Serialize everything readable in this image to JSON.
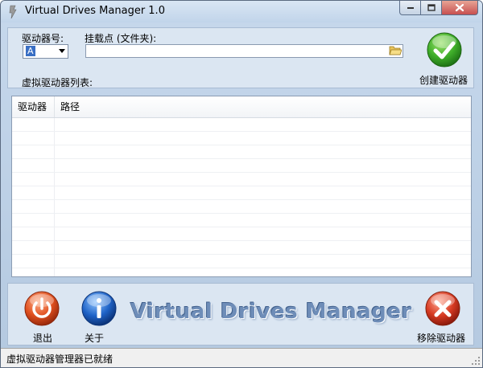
{
  "window": {
    "title": "Virtual Drives Manager 1.0",
    "controls": {
      "minimize": "minimize-icon",
      "maximize": "maximize-icon",
      "close": "close-icon"
    }
  },
  "form": {
    "drive_label": "驱动器号:",
    "drive_value": "A",
    "mount_label": "挂载点 (文件夹):",
    "mount_value": "",
    "list_label": "虚拟驱动器列表:",
    "create_label": "创建驱动器"
  },
  "list": {
    "columns": [
      "驱动器",
      "路径"
    ],
    "rows": []
  },
  "bottom": {
    "exit_label": "退出",
    "about_label": "关于",
    "banner": "Virtual Drives Manager",
    "remove_label": "移除驱动器"
  },
  "status": {
    "text": "虚拟驱动器管理器已就绪"
  },
  "colors": {
    "window_bg": "#c6d8ec",
    "panel_bg": "#dbe6f2",
    "create_green": "#3fae2a",
    "exit_red": "#d4401f",
    "about_blue": "#1f63c7",
    "remove_red": "#d63a22"
  }
}
